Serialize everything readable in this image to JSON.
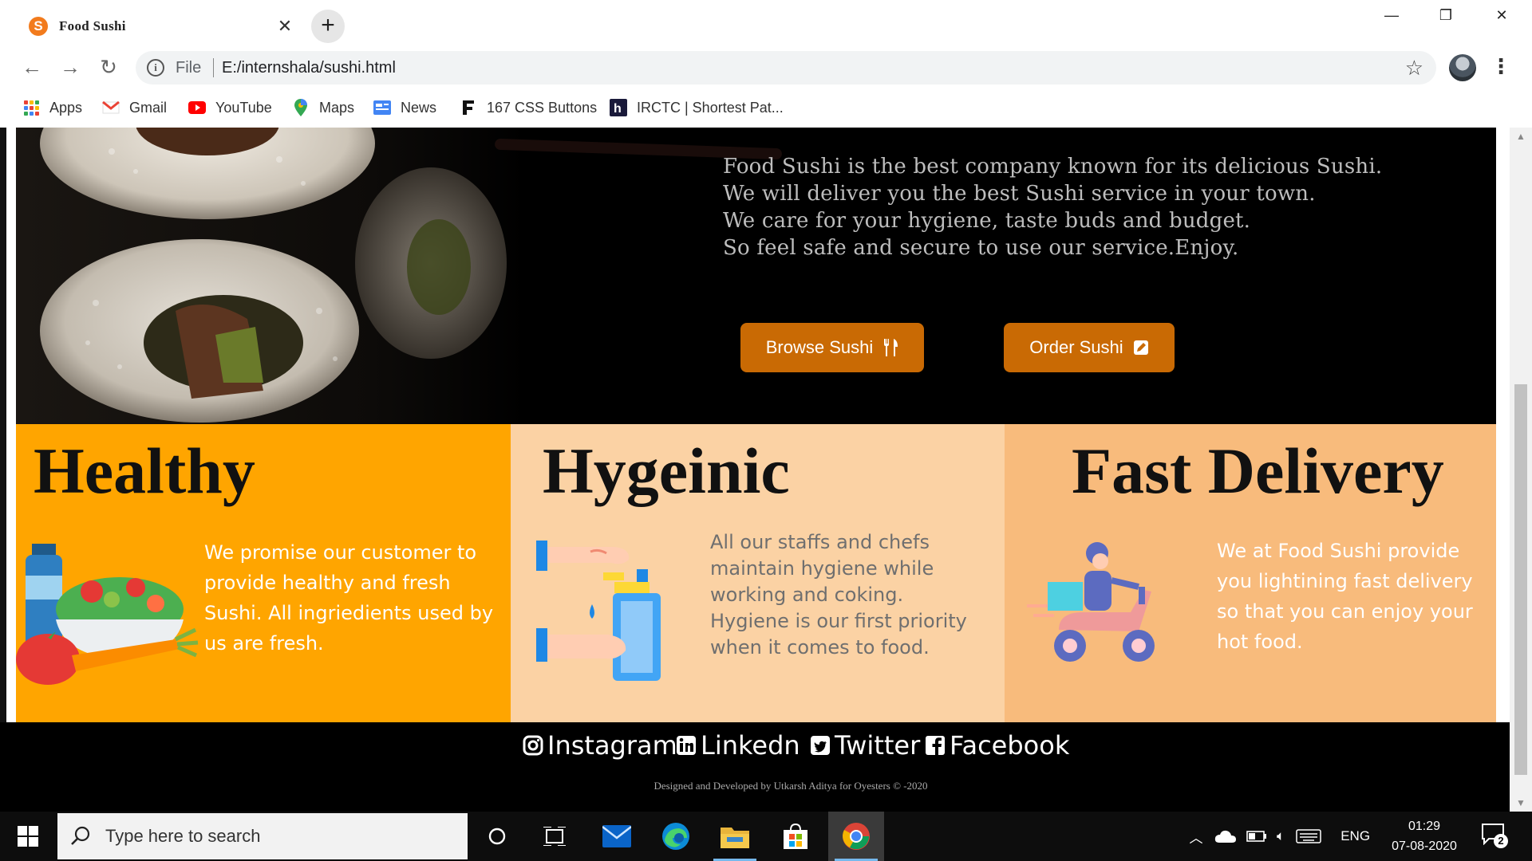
{
  "tab": {
    "title": "Food Sushi",
    "favicon_letter": "S"
  },
  "window": {
    "minimize": "—",
    "restore": "❐",
    "close": "✕"
  },
  "toolbar": {
    "scheme": "File",
    "url": "E:/internshala/sushi.html"
  },
  "bookmarks": [
    {
      "label": "Apps"
    },
    {
      "label": "Gmail"
    },
    {
      "label": "YouTube"
    },
    {
      "label": "Maps"
    },
    {
      "label": "News"
    },
    {
      "label": "167 CSS Buttons"
    },
    {
      "label": "IRCTC | Shortest Pat..."
    }
  ],
  "hero": {
    "lines": [
      "Food Sushi is the best company known for its delicious Sushi.",
      "We will deliver you the best Sushi service in your town.",
      "We care for your hygiene, taste buds and budget.",
      "So feel safe and secure to use our service.Enjoy."
    ],
    "browse_label": "Browse Sushi",
    "order_label": "Order Sushi"
  },
  "features": [
    {
      "title": "Healthy",
      "text": "We promise our customer to provide healthy and fresh Sushi. All ingriedients used by us are fresh.",
      "bg": "#ffa500",
      "color": "#ffffff"
    },
    {
      "title": "Hygeinic",
      "text": "All our staffs and chefs maintain hygiene while working and coking. Hygiene is our first priority when it comes to food.",
      "bg": "#fbd2a4",
      "color": "#6f6f6f"
    },
    {
      "title": "Fast Delivery",
      "text": "We at Food Sushi provide you lightining fast delivery so that you can enjoy your hot food.",
      "bg": "#f8bb7c",
      "color": "#ffffff"
    }
  ],
  "footer": {
    "social": [
      "Instagram",
      "Linkedn",
      "Twitter",
      "Facebook"
    ],
    "credits": "Designed and Developed by Utkarsh Aditya for Oyesters © -2020"
  },
  "taskbar": {
    "search_placeholder": "Type here to search",
    "language": "ENG",
    "time": "01:29",
    "date": "07-08-2020",
    "notifications": "2"
  },
  "colors": {
    "accent_button": "#c96a04",
    "hero_text": "#bdbdbd"
  }
}
